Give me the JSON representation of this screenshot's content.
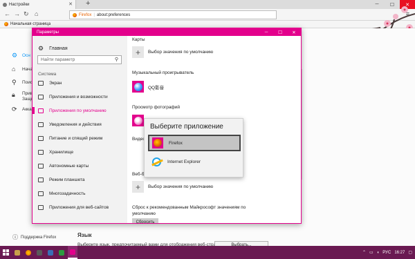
{
  "browser": {
    "tab_title": "Настройки",
    "url_brand": "Firefox",
    "url": "about:preferences",
    "bookmark": "Начальная страница"
  },
  "prefs": {
    "sidebar": [
      {
        "label": "Осн",
        "icon": "gear-icon",
        "active": true
      },
      {
        "label": "Начал",
        "icon": "home-icon",
        "active": false
      },
      {
        "label": "Поиск",
        "icon": "search-icon",
        "active": false
      },
      {
        "label": "Прив",
        "label2": "Защи",
        "icon": "lock-icon",
        "active": false
      },
      {
        "label": "Акка",
        "icon": "sync-icon",
        "active": false
      }
    ],
    "support": "Поддержка Firefox",
    "language_title": "Язык",
    "language_desc": "Выберите язык, предпочитаемый вами для отображения веб-страниц",
    "choose_button": "Выбрать..."
  },
  "settings": {
    "window_title": "Параметры",
    "home": "Главная",
    "search_placeholder": "Найти параметр",
    "section": "Система",
    "nav_items": [
      "Экран",
      "Приложения и возможности",
      "Приложения по умолчанию",
      "Уведомления и действия",
      "Питание и спящий режим",
      "Хранилище",
      "Автономные карты",
      "Режим планшета",
      "Многозадачность",
      "Приложения для веб-сайтов"
    ],
    "active_index": 2,
    "content": {
      "maps_label": "Карты",
      "maps_choose": "Выбор значения по умолчанию",
      "music_label": "Музыкальный проигрыватель",
      "music_app": "QQ影音",
      "photo_label": "Просмотр фотографий",
      "video_label": "Видео",
      "web_label": "Веб-б",
      "web_choose": "Выбор значения по умолчанию",
      "reset_text": "Сброс к рекомендованным Майкрософт значениям по умолчанию",
      "reset_button": "Сбросить"
    }
  },
  "chooser": {
    "title": "Выберите приложение",
    "options": [
      "Firefox",
      "Internet Explorer"
    ],
    "selected": "Firefox"
  },
  "taskbar": {
    "lang": "РУС",
    "time": "16:27"
  },
  "colors": {
    "accent": "#e3008c",
    "taskbar": "#6a1a52",
    "link_blue": "#0996f8"
  }
}
